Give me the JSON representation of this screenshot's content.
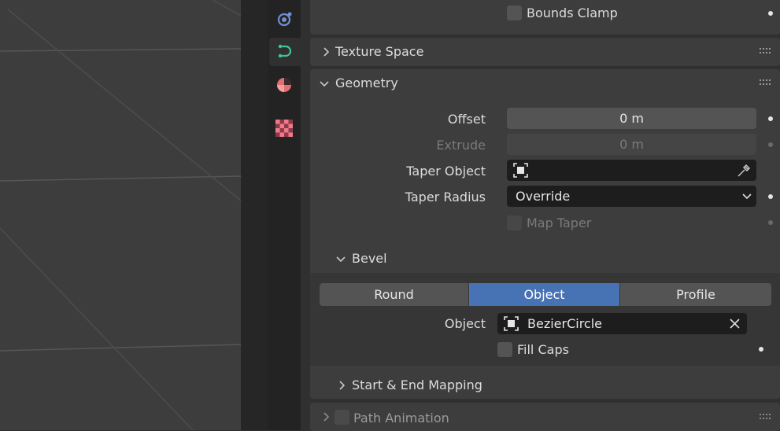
{
  "viewport": {
    "background": "#3d3d3d",
    "grid_color": "#5a5a5a"
  },
  "tabs": [
    {
      "name": "physics-tab",
      "icon": "orbit-physics-icon",
      "active": false
    },
    {
      "name": "curve-data-tab",
      "icon": "curve-data-icon",
      "active": true
    },
    {
      "name": "material-tab",
      "icon": "material-sphere-icon",
      "active": false
    },
    {
      "name": "texture-tab",
      "icon": "checker-texture-icon",
      "active": false
    }
  ],
  "top_row": {
    "bounds_clamp_label": "Bounds Clamp",
    "checked": false
  },
  "texture_space": {
    "title": "Texture Space",
    "expanded": false
  },
  "geometry": {
    "title": "Geometry",
    "expanded": true,
    "offset": {
      "label": "Offset",
      "value": "0 m"
    },
    "extrude": {
      "label": "Extrude",
      "value": "0 m"
    },
    "taper_object": {
      "label": "Taper Object",
      "value": ""
    },
    "taper_radius": {
      "label": "Taper Radius",
      "value": "Override"
    },
    "map_taper": {
      "label": "Map Taper",
      "checked": false
    }
  },
  "bevel": {
    "title": "Bevel",
    "expanded": true,
    "modes": [
      "Round",
      "Object",
      "Profile"
    ],
    "active_mode": "Object",
    "object": {
      "label": "Object",
      "value": "BezierCircle"
    },
    "fill_caps": {
      "label": "Fill Caps",
      "checked": false
    },
    "start_end_mapping": {
      "title": "Start & End Mapping",
      "expanded": false
    }
  },
  "path_animation": {
    "title": "Path Animation",
    "expanded": false,
    "enabled": false
  },
  "colors": {
    "accent": "#4772b3",
    "panel": "#3d3d3d",
    "background": "#303030",
    "field": "#545454",
    "field_dark": "#1d1d1d",
    "curve_tab_icon": "#3ec690",
    "physics_tab_icon": "#6f8fd4",
    "material_tab_icon": "#e36e6e"
  }
}
